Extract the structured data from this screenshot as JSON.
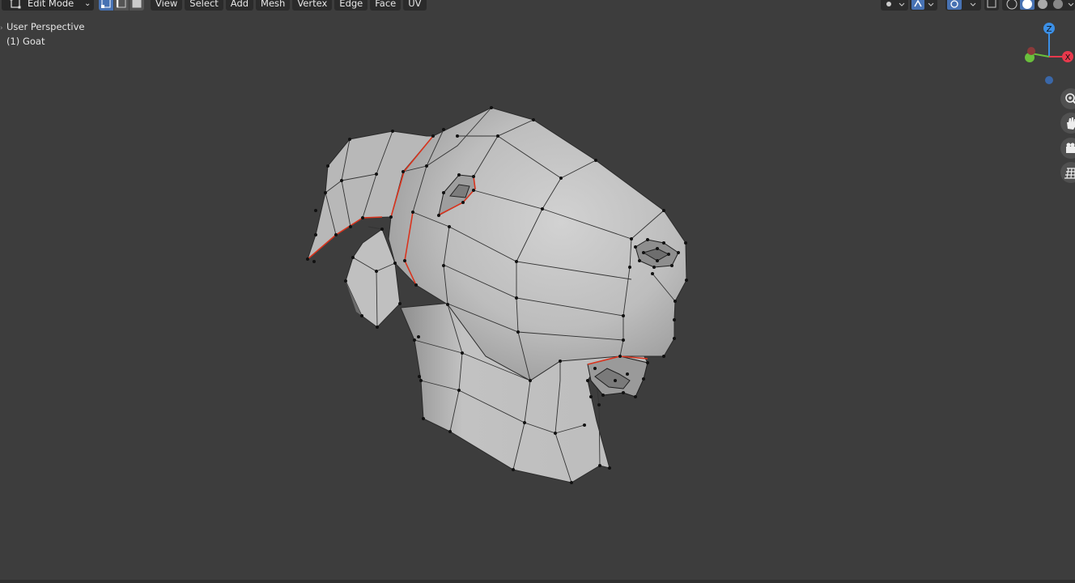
{
  "header": {
    "mode": "Edit Mode",
    "menus": [
      "View",
      "Select",
      "Add",
      "Mesh",
      "Vertex",
      "Edge",
      "Face",
      "UV"
    ]
  },
  "overlay": {
    "perspective": "User Perspective",
    "object": "(1) Goat"
  },
  "gizmo": {
    "z_label": "Z",
    "x_label": "X",
    "colors": {
      "x": "#e8394c",
      "y": "#6abf3c",
      "z": "#3b8fe6"
    }
  },
  "icons": {
    "mode": "edit-mode-icon",
    "vertex_select": "vertex-select-icon",
    "edge_select": "edge-select-icon",
    "face_select": "face-select-icon",
    "zoom": "zoom-icon",
    "pan": "hand-icon",
    "camera": "camera-icon",
    "grid": "grid-icon"
  },
  "colors": {
    "background": "#3d3d3d",
    "mesh_face": "#c8c8c8",
    "seam": "#d9341e",
    "accent": "#4772b3"
  }
}
